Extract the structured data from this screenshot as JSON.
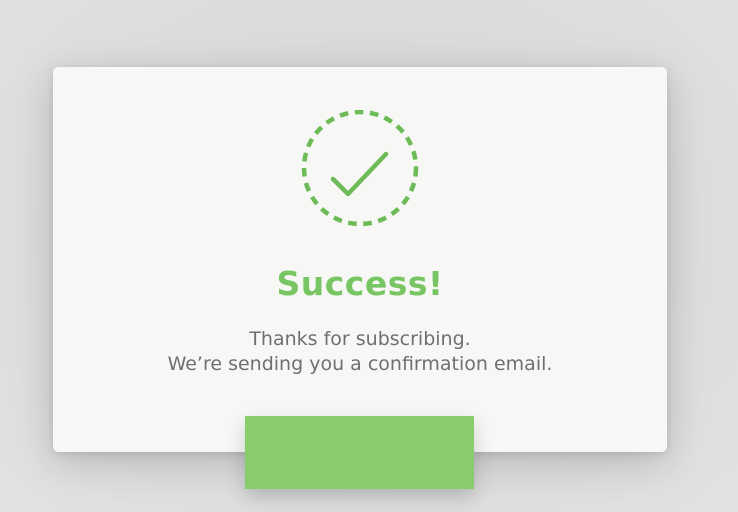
{
  "modal": {
    "title": "Success!",
    "message_line1": "Thanks for subscribing.",
    "message_line2": "We’re sending you a confirmation email.",
    "icon": "check-circle-dashed-icon",
    "button_label": ""
  },
  "colors": {
    "accent": "#78c663",
    "button": "#89cc6e",
    "text": "#6f6f6f",
    "modal_bg": "#f7f7f5",
    "backdrop": "#dcdcdc"
  }
}
